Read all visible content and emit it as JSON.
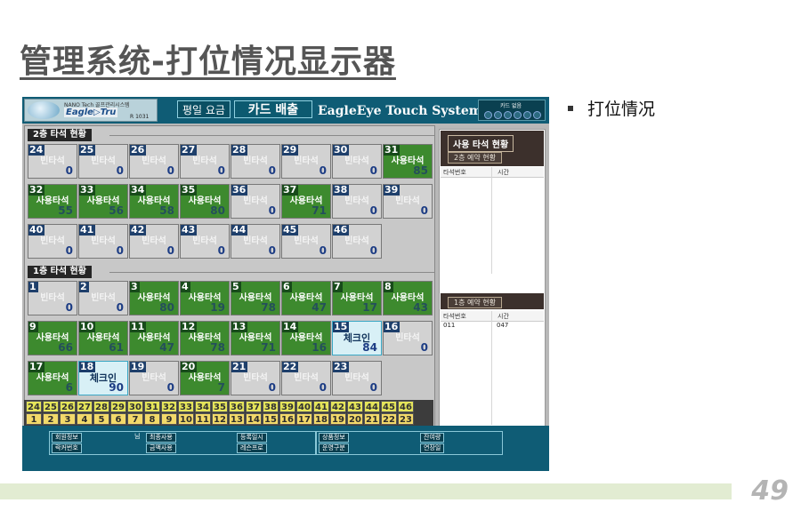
{
  "slide": {
    "title": "管理系统-打位情况显示器",
    "bullet": "打位情况",
    "page_number": "49"
  },
  "app": {
    "logo": {
      "line1": "NANO Tech 골프관리시스템",
      "line2": "Eagle▷Tru",
      "code": "R 1031"
    },
    "header_buttons": [
      "평일 요금",
      "카드 배출"
    ],
    "system_title": "EagleEye Touch System",
    "card_status_label": "카드 없음",
    "colors": {
      "header": "#0f5c75",
      "used_bay": "#3d8a2e",
      "idle_bay": "#d2d2d2",
      "checkin_bay": "#d8f0f6",
      "index_top": "#e4e45a",
      "index_bottom": "#f2d96a"
    },
    "floor2": {
      "label": "2층 타석 현황",
      "bays": [
        {
          "num": "24",
          "status": "빈타석",
          "count": "0",
          "state": "idle"
        },
        {
          "num": "25",
          "status": "빈타석",
          "count": "0",
          "state": "idle"
        },
        {
          "num": "26",
          "status": "빈타석",
          "count": "0",
          "state": "idle"
        },
        {
          "num": "27",
          "status": "빈타석",
          "count": "0",
          "state": "idle"
        },
        {
          "num": "28",
          "status": "빈타석",
          "count": "0",
          "state": "idle"
        },
        {
          "num": "29",
          "status": "빈타석",
          "count": "0",
          "state": "idle"
        },
        {
          "num": "30",
          "status": "빈타석",
          "count": "0",
          "state": "idle"
        },
        {
          "num": "31",
          "status": "사용타석",
          "count": "85",
          "state": "used"
        },
        {
          "num": "32",
          "status": "사용타석",
          "count": "55",
          "state": "used"
        },
        {
          "num": "33",
          "status": "사용타석",
          "count": "56",
          "state": "used"
        },
        {
          "num": "34",
          "status": "사용타석",
          "count": "58",
          "state": "used"
        },
        {
          "num": "35",
          "status": "사용타석",
          "count": "80",
          "state": "used"
        },
        {
          "num": "36",
          "status": "빈타석",
          "count": "0",
          "state": "idle"
        },
        {
          "num": "37",
          "status": "사용타석",
          "count": "71",
          "state": "used"
        },
        {
          "num": "38",
          "status": "빈타석",
          "count": "0",
          "state": "idle"
        },
        {
          "num": "39",
          "status": "빈타석",
          "count": "0",
          "state": "idle"
        },
        {
          "num": "40",
          "status": "빈타석",
          "count": "0",
          "state": "idle"
        },
        {
          "num": "41",
          "status": "빈타석",
          "count": "0",
          "state": "idle"
        },
        {
          "num": "42",
          "status": "빈타석",
          "count": "0",
          "state": "idle"
        },
        {
          "num": "43",
          "status": "빈타석",
          "count": "0",
          "state": "idle"
        },
        {
          "num": "44",
          "status": "빈타석",
          "count": "0",
          "state": "idle"
        },
        {
          "num": "45",
          "status": "빈타석",
          "count": "0",
          "state": "idle"
        },
        {
          "num": "46",
          "status": "빈타석",
          "count": "0",
          "state": "idle"
        }
      ]
    },
    "floor1": {
      "label": "1층 타석 현황",
      "bays": [
        {
          "num": "1",
          "status": "빈타석",
          "count": "0",
          "state": "idle"
        },
        {
          "num": "2",
          "status": "빈타석",
          "count": "0",
          "state": "idle"
        },
        {
          "num": "3",
          "status": "사용타석",
          "count": "80",
          "state": "used"
        },
        {
          "num": "4",
          "status": "사용타석",
          "count": "19",
          "state": "used"
        },
        {
          "num": "5",
          "status": "사용타석",
          "count": "78",
          "state": "used"
        },
        {
          "num": "6",
          "status": "사용타석",
          "count": "47",
          "state": "used"
        },
        {
          "num": "7",
          "status": "사용타석",
          "count": "17",
          "state": "used"
        },
        {
          "num": "8",
          "status": "사용타석",
          "count": "43",
          "state": "used"
        },
        {
          "num": "9",
          "status": "사용타석",
          "count": "66",
          "state": "used"
        },
        {
          "num": "10",
          "status": "사용타석",
          "count": "61",
          "state": "used"
        },
        {
          "num": "11",
          "status": "사용타석",
          "count": "47",
          "state": "used"
        },
        {
          "num": "12",
          "status": "사용타석",
          "count": "78",
          "state": "used"
        },
        {
          "num": "13",
          "status": "사용타석",
          "count": "71",
          "state": "used"
        },
        {
          "num": "14",
          "status": "사용타석",
          "count": "16",
          "state": "used"
        },
        {
          "num": "15",
          "status": "체크인",
          "count": "84",
          "state": "checkin"
        },
        {
          "num": "16",
          "status": "빈타석",
          "count": "0",
          "state": "idle"
        },
        {
          "num": "17",
          "status": "사용타석",
          "count": "6",
          "state": "used"
        },
        {
          "num": "18",
          "status": "체크인",
          "count": "90",
          "state": "checkin"
        },
        {
          "num": "19",
          "status": "빈타석",
          "count": "0",
          "state": "idle"
        },
        {
          "num": "20",
          "status": "사용타석",
          "count": "7",
          "state": "used"
        },
        {
          "num": "21",
          "status": "빈타석",
          "count": "0",
          "state": "idle"
        },
        {
          "num": "22",
          "status": "빈타석",
          "count": "0",
          "state": "idle"
        },
        {
          "num": "23",
          "status": "빈타석",
          "count": "0",
          "state": "idle"
        }
      ]
    },
    "index_top": [
      "24",
      "25",
      "26",
      "27",
      "28",
      "29",
      "30",
      "31",
      "32",
      "33",
      "34",
      "35",
      "36",
      "37",
      "38",
      "39",
      "40",
      "41",
      "42",
      "43",
      "44",
      "45",
      "46"
    ],
    "index_bottom": [
      "1",
      "2",
      "3",
      "4",
      "5",
      "6",
      "7",
      "8",
      "9",
      "10",
      "11",
      "12",
      "13",
      "14",
      "15",
      "16",
      "17",
      "18",
      "19",
      "20",
      "21",
      "22",
      "23"
    ],
    "usage_panel": {
      "title": "사용 타석 현황",
      "floor2_reservation": "2층 예약 현황",
      "floor1_reservation": "1층 예약 현황",
      "col_bay": "타석번호",
      "col_time": "시간",
      "floor1_rows": [
        {
          "bay": "011",
          "time": "047"
        }
      ]
    },
    "bottom": {
      "member_info": "회원정보",
      "card_number": "락커번호",
      "pre_use": "최종사용",
      "amount_used": "금액사용",
      "register_date": "등록일시",
      "remaining": "레슨프로",
      "product_info": "상품정보",
      "product_type": "운영구분",
      "expiry": "잔여량",
      "usage": "연장일",
      "misc": "님"
    }
  }
}
